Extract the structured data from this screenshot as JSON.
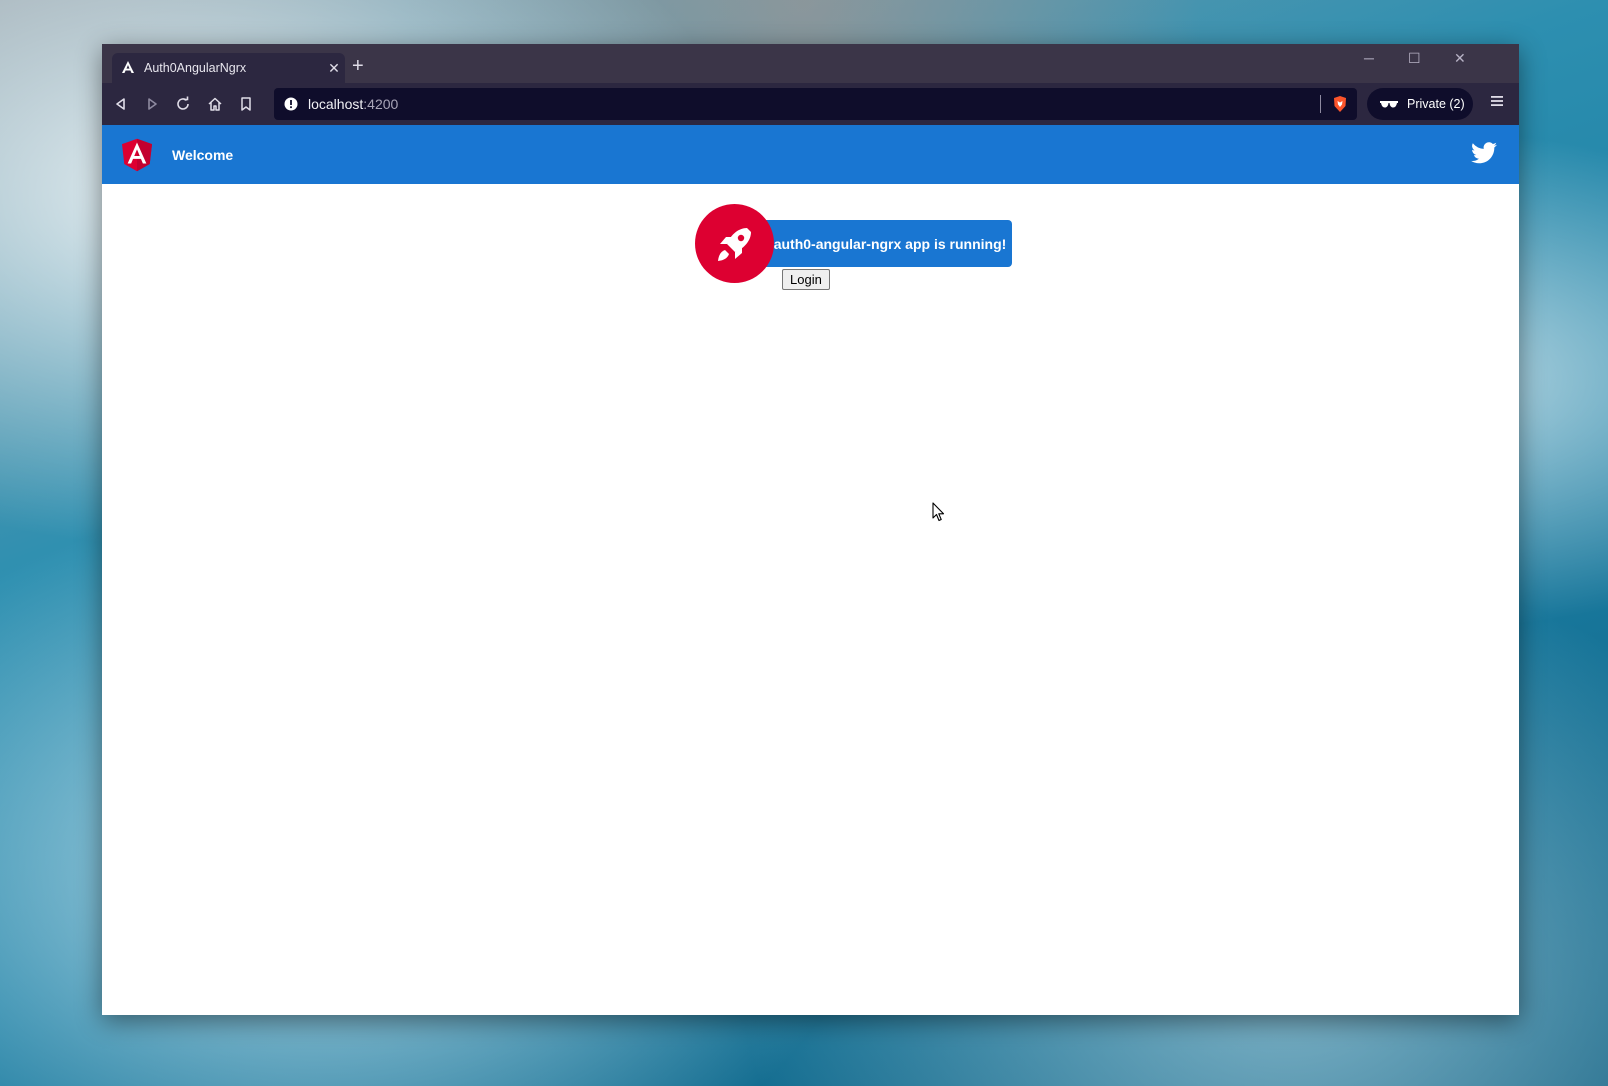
{
  "browser": {
    "tab": {
      "title": "Auth0AngularNgrx",
      "favicon": "angular-icon"
    },
    "address": {
      "host": "localhost",
      "port": ":4200"
    },
    "private_label": "Private (2)",
    "colors": {
      "titlebar": "#3b3548",
      "toolbar": "#2c2740",
      "urlbar": "#0f0d2b"
    }
  },
  "app": {
    "header": {
      "title": "Welcome",
      "accent": "#1976d2"
    },
    "card": {
      "message": "auth0-angular-ngrx app is running!",
      "rocket_color": "#dd0031"
    },
    "login_label": "Login"
  }
}
